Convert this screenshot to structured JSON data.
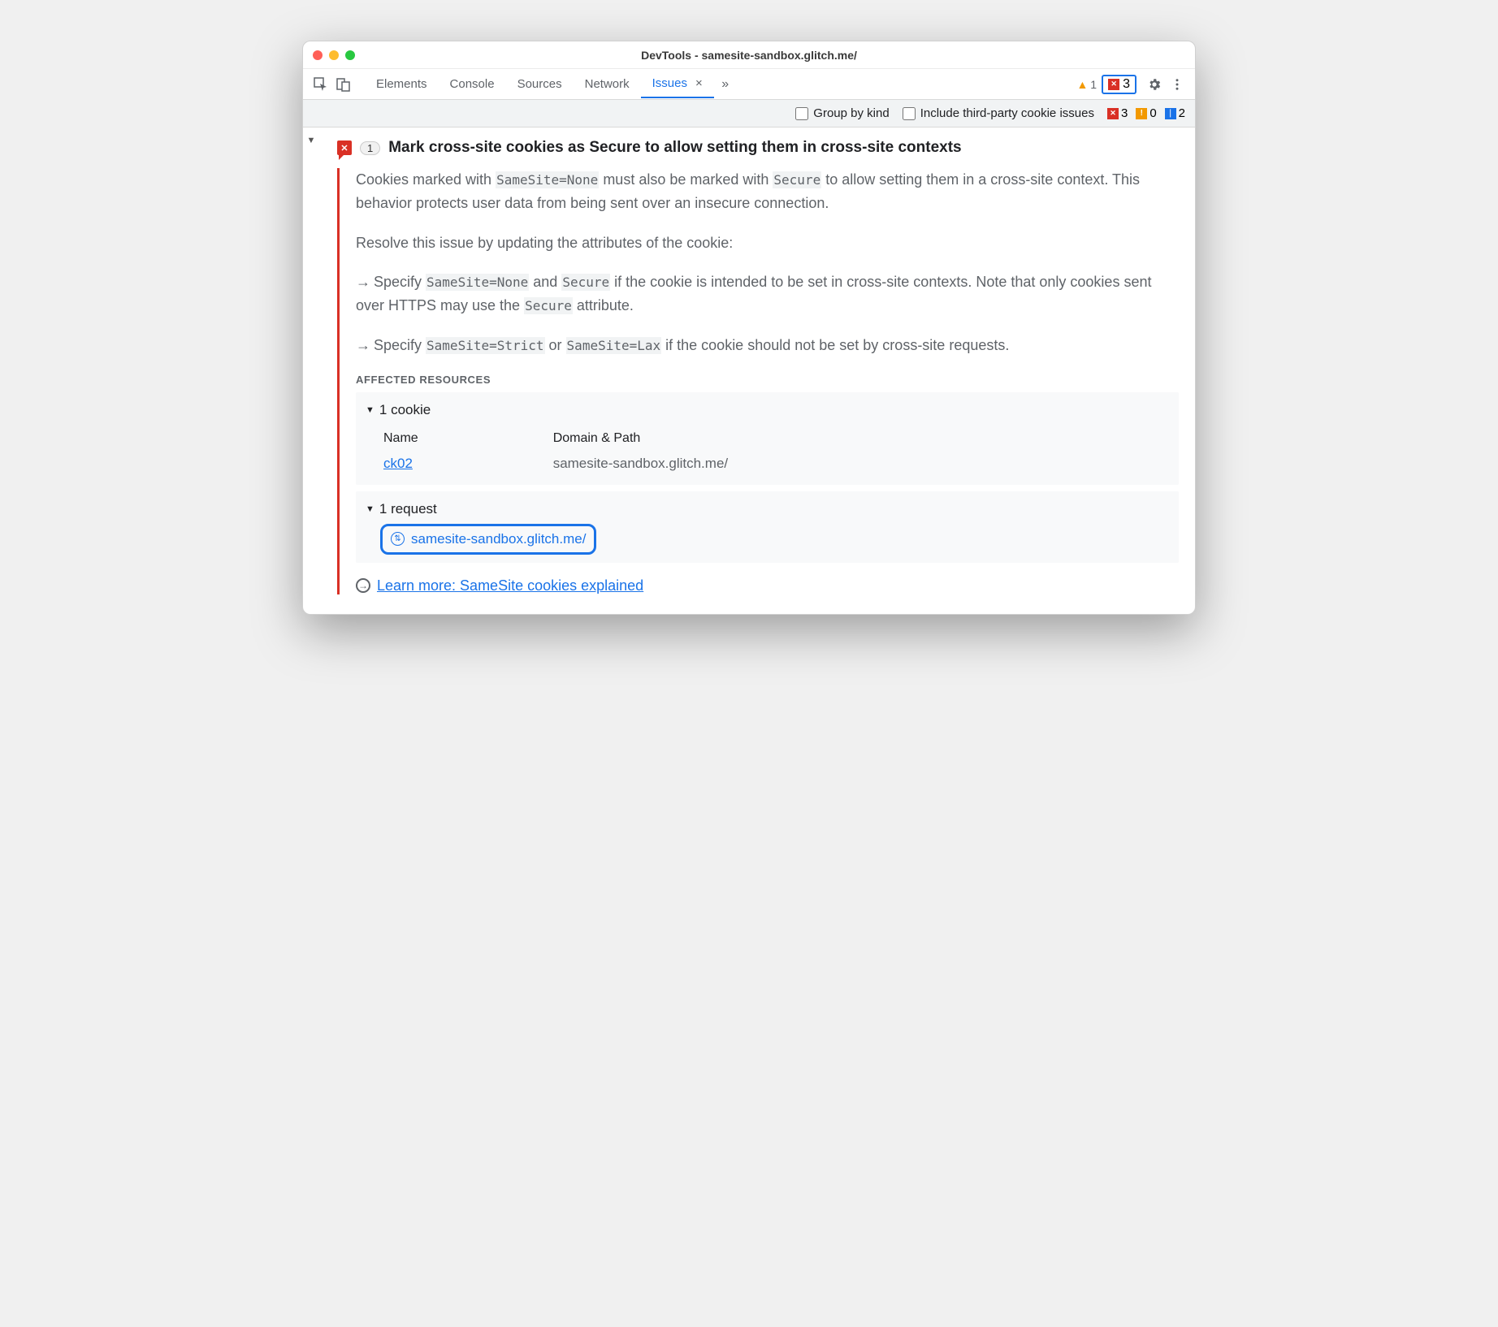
{
  "window": {
    "title": "DevTools - samesite-sandbox.glitch.me/"
  },
  "tabs": [
    "Elements",
    "Console",
    "Sources",
    "Network",
    "Issues"
  ],
  "topbadges": {
    "warn_count": "1",
    "err_count": "3"
  },
  "filter": {
    "group_label": "Group by kind",
    "thirdparty_label": "Include third-party cookie issues",
    "err": "3",
    "warn": "0",
    "info": "2"
  },
  "issue": {
    "count": "1",
    "title": "Mark cross-site cookies as Secure to allow setting them in cross-site contexts"
  },
  "desc": {
    "p1a": "Cookies marked with ",
    "p1_code1": "SameSite=None",
    "p1b": " must also be marked with ",
    "p1_code2": "Secure",
    "p1c": " to allow setting them in a cross-site context. This behavior protects user data from being sent over an insecure connection.",
    "p2": "Resolve this issue by updating the attributes of the cookie:",
    "b1a": "Specify ",
    "b1_code1": "SameSite=None",
    "b1b": " and ",
    "b1_code2": "Secure",
    "b1c": " if the cookie is intended to be set in cross-site contexts. Note that only cookies sent over HTTPS may use the ",
    "b1_code3": "Secure",
    "b1d": " attribute.",
    "b2a": "Specify ",
    "b2_code1": "SameSite=Strict",
    "b2b": " or ",
    "b2_code2": "SameSite=Lax",
    "b2c": " if the cookie should not be set by cross-site requests."
  },
  "affected": {
    "title": "AFFECTED RESOURCES",
    "cookies_header": "1 cookie",
    "col_name": "Name",
    "col_domain": "Domain & Path",
    "cookie_name": "ck02",
    "cookie_domain": "samesite-sandbox.glitch.me/",
    "requests_header": "1 request",
    "request_url": "samesite-sandbox.glitch.me/"
  },
  "learn_more": "Learn more: SameSite cookies explained"
}
